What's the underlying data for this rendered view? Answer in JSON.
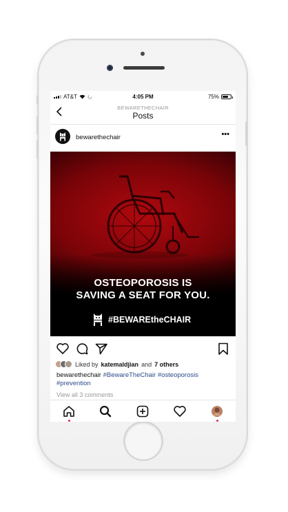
{
  "status_bar": {
    "carrier": "AT&T",
    "time": "4:05 PM",
    "battery": "75%",
    "battery_level": 0.75
  },
  "nav": {
    "subtitle": "BEWARETHECHAIR",
    "title": "Posts",
    "back_icon": "chevron-left-icon"
  },
  "post": {
    "username": "bewarethechair",
    "more_icon": "ellipsis-icon",
    "image": {
      "headline_line1": "OSTEOPOROSIS IS",
      "headline_line2": "SAVING A SEAT FOR YOU.",
      "tagline": "#BEWAREtheCHAIR"
    },
    "likes": {
      "prefix": "Liked by",
      "user": "katemaldjian",
      "and": "and",
      "others": "7 others"
    },
    "caption": {
      "username": "bewarethechair",
      "tag1": "#BewareTheChair",
      "tag2": "#osteoporosis",
      "tag3": "#prevention"
    },
    "comments_link": "View all 3 comments"
  },
  "colors": {
    "image_red": "#b0090e",
    "hashtag": "#2b4a8a",
    "notification_dot": "#e0245e"
  },
  "tab_bar": {
    "items": [
      "home-icon",
      "search-icon",
      "new-post-icon",
      "activity-heart-icon",
      "profile-avatar-icon"
    ]
  }
}
